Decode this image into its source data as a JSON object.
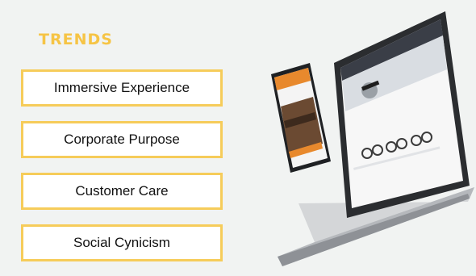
{
  "slide": {
    "title": "TRENDS",
    "trends": [
      {
        "label": "Immersive Experience"
      },
      {
        "label": "Corporate Purpose"
      },
      {
        "label": "Customer Care"
      },
      {
        "label": "Social Cynicism"
      }
    ]
  },
  "colors": {
    "accent": "#f6c445",
    "box_border": "#f6cc5a",
    "background": "#f1f3f2",
    "device_dark": "#2b2d30",
    "phone_orange": "#e8892d"
  },
  "illustration": {
    "phone_icon": "smartphone-icon",
    "laptop_icon": "laptop-icon"
  }
}
